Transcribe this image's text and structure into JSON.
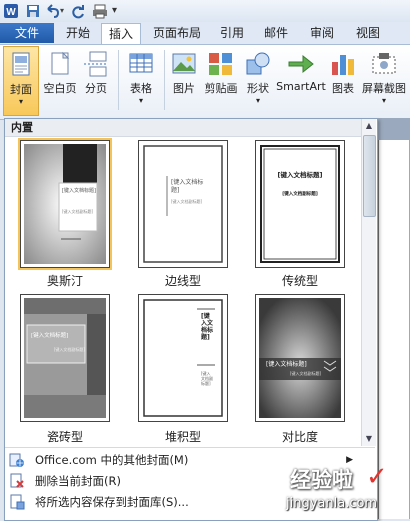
{
  "quick_access": {
    "app_icon": "word-icon",
    "save_icon": "save-icon",
    "undo_icon": "undo-icon",
    "redo_icon": "redo-icon",
    "print_icon": "print-preview-icon",
    "customize": "▾"
  },
  "tabs": [
    {
      "label": "文件"
    },
    {
      "label": "开始"
    },
    {
      "label": "插入"
    },
    {
      "label": "页面布局"
    },
    {
      "label": "引用"
    },
    {
      "label": "邮件"
    },
    {
      "label": "审阅"
    },
    {
      "label": "视图"
    }
  ],
  "ribbon": {
    "cover": "封面",
    "blank": "空白页",
    "page_break": "分页",
    "table": "表格",
    "picture": "图片",
    "clipart": "剪贴画",
    "shapes": "形状",
    "smartart": "SmartArt",
    "chart": "图表",
    "screenshot": "屏幕截图"
  },
  "gallery": {
    "header": "内置",
    "items": [
      {
        "label": "奥斯汀",
        "title": "[键入文档标题]",
        "subtitle": "[键入文档副标题]"
      },
      {
        "label": "边线型",
        "title": "[键入文档标题]",
        "subtitle": "[键入文档副标题]"
      },
      {
        "label": "传统型",
        "title": "[键入文档标题]",
        "subtitle": "[键入文档副标题]"
      },
      {
        "label": "瓷砖型",
        "title": "[键入文档标题]",
        "subtitle": "[键入文档副标题]"
      },
      {
        "label": "堆积型",
        "title": "[键入文档标题]",
        "subtitle": "[键入文档副标题]"
      },
      {
        "label": "对比度",
        "title": "[键入文档标题]",
        "subtitle": "[键入文档副标题]"
      }
    ]
  },
  "menu": {
    "more": "Office.com 中的其他封面(M)",
    "remove": "删除当前封面(R)",
    "save": "将所选内容保存到封面库(S)..."
  },
  "watermark": {
    "text": "经验啦",
    "domain": "jingyanla.com",
    "check": "✓"
  },
  "colors": {
    "file_tab": "#2a66b8",
    "accent": "#f4c35a",
    "ribbon_bg": "#eef3fa"
  }
}
